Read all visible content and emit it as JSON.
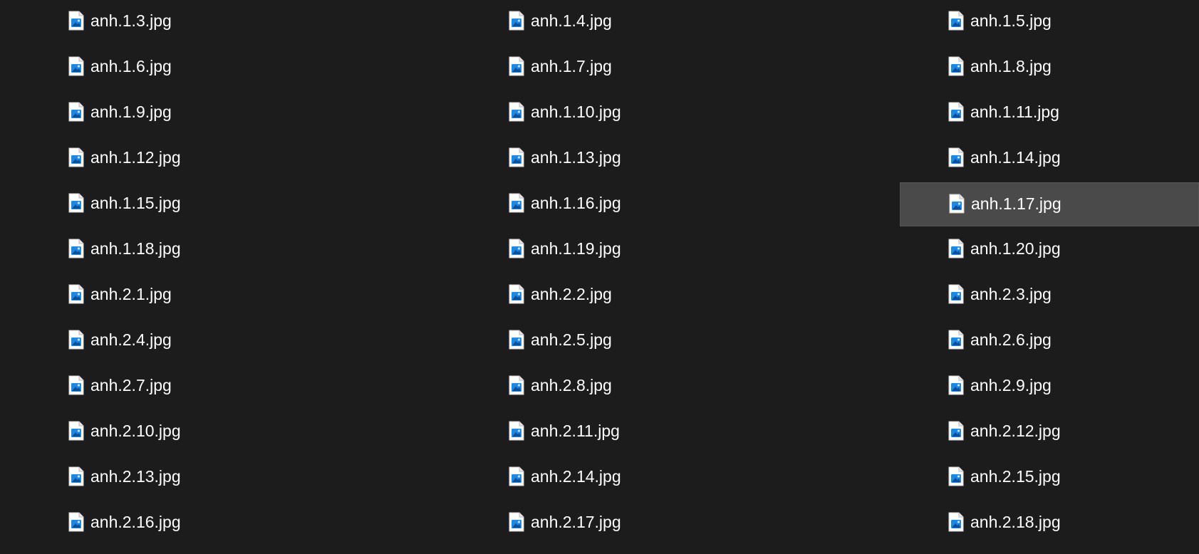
{
  "explorer": {
    "colors": {
      "background": "#1c1c1c",
      "text": "#ffffff",
      "selection": "#4a4a4a",
      "icon_accent": "#1e88e5"
    },
    "file_icon": "image-file-icon",
    "selected_file": "anh.1.17.jpg",
    "files": [
      "anh.1.3.jpg",
      "anh.1.4.jpg",
      "anh.1.5.jpg",
      "anh.1.6.jpg",
      "anh.1.7.jpg",
      "anh.1.8.jpg",
      "anh.1.9.jpg",
      "anh.1.10.jpg",
      "anh.1.11.jpg",
      "anh.1.12.jpg",
      "anh.1.13.jpg",
      "anh.1.14.jpg",
      "anh.1.15.jpg",
      "anh.1.16.jpg",
      "anh.1.17.jpg",
      "anh.1.18.jpg",
      "anh.1.19.jpg",
      "anh.1.20.jpg",
      "anh.2.1.jpg",
      "anh.2.2.jpg",
      "anh.2.3.jpg",
      "anh.2.4.jpg",
      "anh.2.5.jpg",
      "anh.2.6.jpg",
      "anh.2.7.jpg",
      "anh.2.8.jpg",
      "anh.2.9.jpg",
      "anh.2.10.jpg",
      "anh.2.11.jpg",
      "anh.2.12.jpg",
      "anh.2.13.jpg",
      "anh.2.14.jpg",
      "anh.2.15.jpg",
      "anh.2.16.jpg",
      "anh.2.17.jpg",
      "anh.2.18.jpg"
    ]
  }
}
